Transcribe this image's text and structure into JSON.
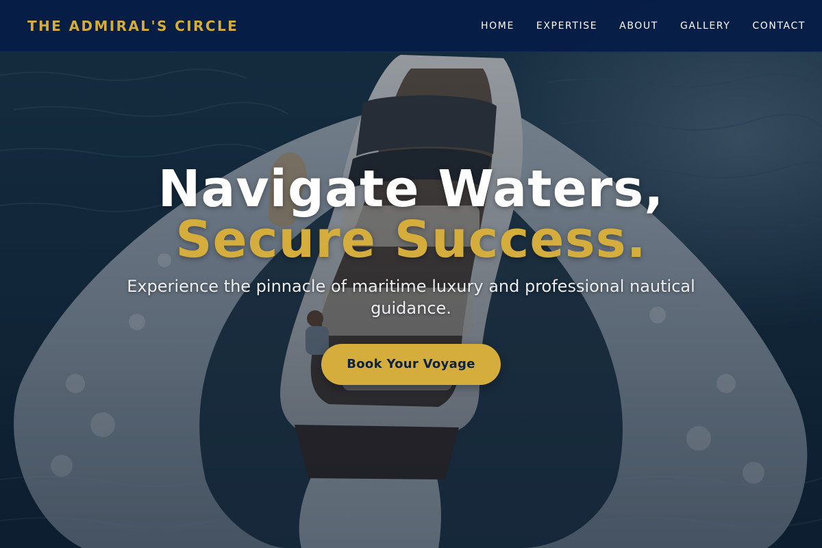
{
  "brand": {
    "name": "THE ADMIRAL'S CIRCLE",
    "color": "#d4ad3c"
  },
  "nav": {
    "items": [
      {
        "label": "HOME"
      },
      {
        "label": "EXPERTISE"
      },
      {
        "label": "ABOUT"
      },
      {
        "label": "GALLERY"
      },
      {
        "label": "CONTACT"
      }
    ]
  },
  "hero": {
    "headline_line1": "Navigate Waters,",
    "headline_line2": "Secure Success.",
    "subheading": "Experience the pinnacle of maritime luxury and professional nautical guidance.",
    "cta_label": "Book Your Voyage",
    "background_image": "speedboat-aerial-photo"
  },
  "colors": {
    "accent_gold": "#d4ad3c",
    "navbar_navy": "#051c46",
    "cta_text": "#0c2240"
  }
}
